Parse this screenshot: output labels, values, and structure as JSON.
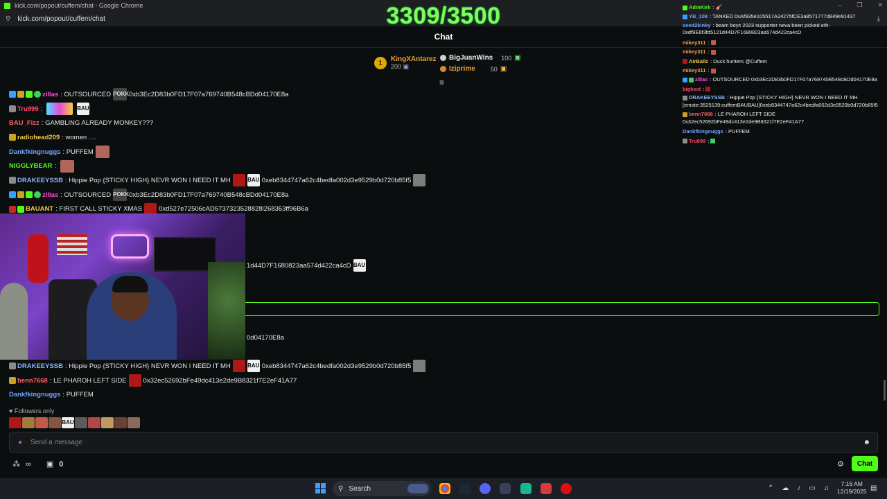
{
  "browser": {
    "window_title": "kick.com/popout/cuffem/chat - Google Chrome",
    "url": "kick.com/popout/cuffem/chat"
  },
  "goal": {
    "text": "3309/3500"
  },
  "chat_header": {
    "title": "Chat"
  },
  "leaderboard": {
    "first": {
      "rank": "1",
      "name": "KingXAntarez",
      "value": "200"
    },
    "second": {
      "name": "BigJuanWins",
      "value": "100"
    },
    "third": {
      "name": "Iziprime",
      "value": "50"
    }
  },
  "chat_lines": [
    {
      "user": "zillas",
      "color": "#ff4ad8",
      "text": "OUTSOURCED",
      "emote": "POKK",
      "extra": "0xb3Ec2D83b0FD17F07a769740B548cBDd04170E8a"
    },
    {
      "user": "Tru999",
      "color": "#ff4a6a",
      "text": "",
      "emote": "BAU"
    },
    {
      "user": "BAU_Fizz",
      "color": "#ff6060",
      "text": "GAMBLING ALREADY MONKEY???"
    },
    {
      "user": "radiohead209",
      "color": "#f0c84a",
      "text": "women ...."
    },
    {
      "user": "Dankfkingnuggs",
      "color": "#6ea4ff",
      "text": "PUFFEM"
    },
    {
      "user": "NIGGLYBEAR",
      "color": "#53fc18",
      "text": ""
    },
    {
      "user": "DRAKEEYSSB",
      "color": "#8ab4ff",
      "text": "Hippie Pop {STICKY HIGH} NEVR WON I NEED IT MH",
      "emote": "BAU",
      "extra": "0xeb8344747a62c4bedfa002d3e9529b0d720b85f5"
    },
    {
      "user": "zillas",
      "color": "#ff4ad8",
      "text": "OUTSOURCED",
      "emote": "POKK",
      "extra": "0xb3Ec2D83b0FD17F07a769740B548cBDd04170E8a"
    },
    {
      "user": "BAUANT",
      "color": "#f0c84a",
      "text": "FIRST CALL STICKY XMAS",
      "extra": "0xd527e72506cAD5737323528828l268363ff96B6a"
    }
  ],
  "hidden_fragments": {
    "line_a": "1d44D7F1680823aa574d422ca4cD",
    "line_a_emote": "BAU",
    "line_b": "0d04170E8a"
  },
  "chat_lines_bottom": [
    {
      "user": "DRAKEEYSSB",
      "color": "#8ab4ff",
      "text": "Hippie Pop {STICKY HIGH} NEVR WON I NEED IT MH",
      "emote": "BAU",
      "extra": "0xeb8344747a62c4bedfa002d3e9529b0d720b85f5"
    },
    {
      "user": "benn7668",
      "color": "#ff6060",
      "text": "LE PHAROH LEFT SIDE",
      "extra": "0x32ec52692bFe49dc413e2de9B8321f7E2eF41A77"
    },
    {
      "user": "Dankfkingnuggs",
      "color": "#6ea4ff",
      "text": "PUFFEM"
    }
  ],
  "followers_only": "Followers only",
  "emote_bar_label": "BAU",
  "message_input": {
    "placeholder": "Send a message"
  },
  "bottom": {
    "count": "0",
    "chat_button": "Chat"
  },
  "side_chat": [
    {
      "user": "AdinKirk",
      "color": "#53fc18",
      "text": ""
    },
    {
      "user": "YB_108",
      "color": "#6ea4ff",
      "text": "TANKED 0xAf935e105517A24275fCE3a8571777d849e91437"
    },
    {
      "user": "seed2kinky",
      "color": "#6ea4ff",
      "text": "beam boys 2023 supporter neva been picked eth- 0xdf9E6f3fd5121d44D7F1680823aa574d422ca4cD",
      "wrap": true
    },
    {
      "user": "mikey311",
      "color": "#ff9a4a",
      "text": ""
    },
    {
      "user": "mikey311",
      "color": "#ff9a4a",
      "text": ""
    },
    {
      "user": "AirBallz",
      "color": "#f0c84a",
      "text": "Duck hunters @Cuffem"
    },
    {
      "user": "mikey311",
      "color": "#ff9a4a",
      "text": ""
    },
    {
      "user": "zillas",
      "color": "#ff4ad8",
      "text": "OUTSOURCED 0xb3Ec2D83b0FD17F07a769740B548cBDd04170E8a"
    },
    {
      "user": "bigkxxt",
      "color": "#ff4a6a",
      "text": ""
    },
    {
      "user": "DRAKEEYSSB",
      "color": "#8ab4ff",
      "text": "Hippie Pop {STICKY HIGH} NEVR WON I NEED IT MH [emote:3525139:cuffemBAUBAU]0xeb8344747a62c4bedfa002d3e9529b0d720b85f5",
      "wrap": true
    },
    {
      "user": "benn7668",
      "color": "#ff6060",
      "text": "LE PHAROH LEFT SIDE 0x32ec52692bFe49dc413e2de9B8321f7E2eF41A77",
      "wrap": true
    },
    {
      "user": "Dankfkingnuggs",
      "color": "#6ea4ff",
      "text": "PUFFEM"
    },
    {
      "user": "Tru999",
      "color": "#ff4a6a",
      "text": ""
    }
  ],
  "taskbar": {
    "search_label": "Search",
    "time": "7:16 AM",
    "date": "12/19/2025"
  }
}
